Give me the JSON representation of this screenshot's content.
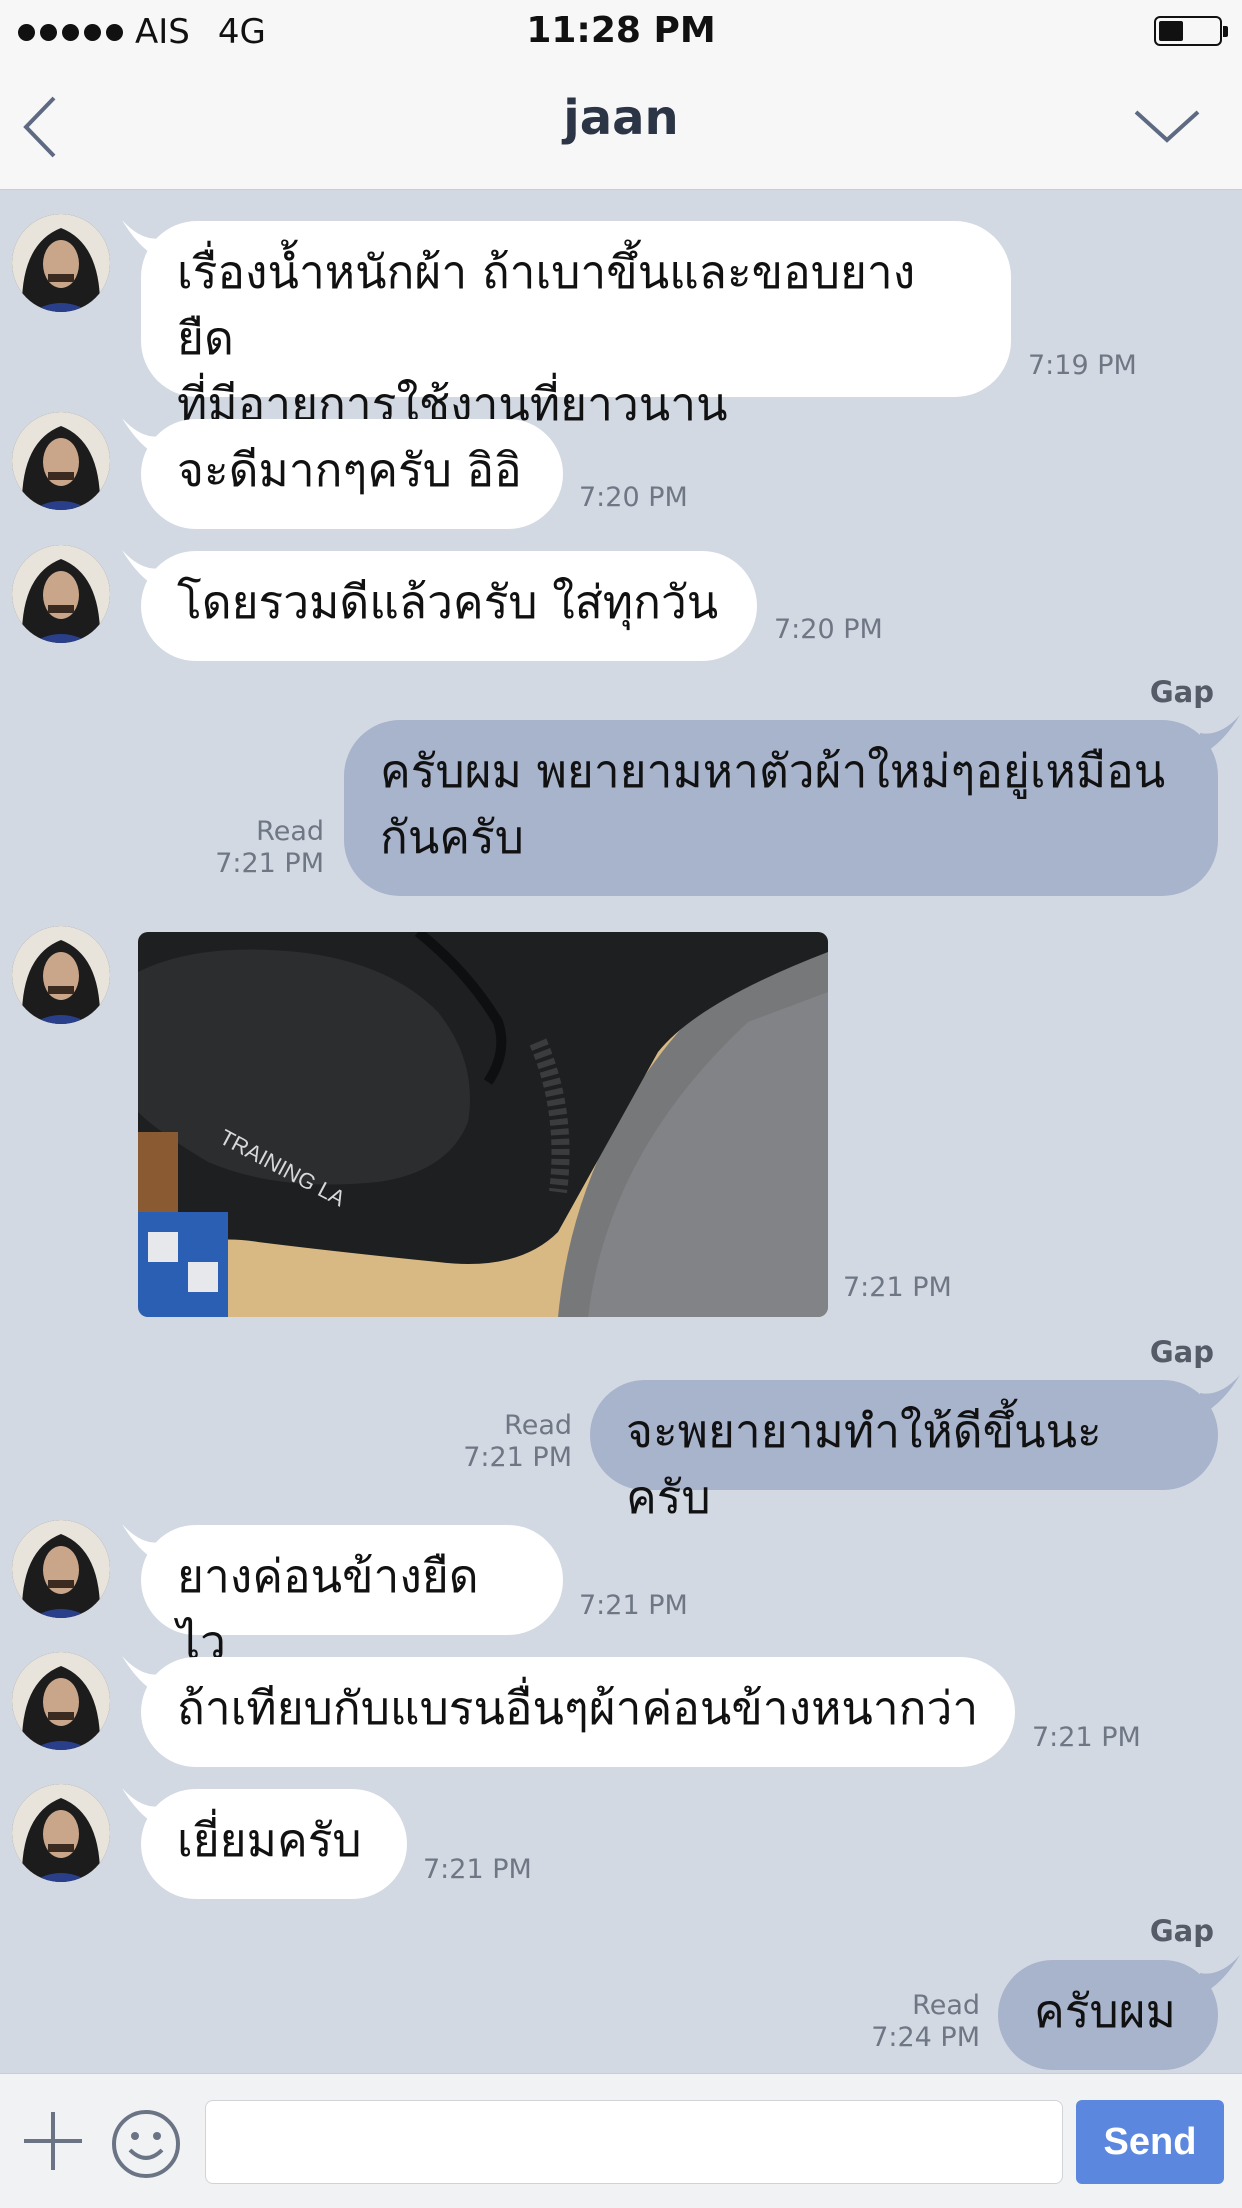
{
  "status_bar": {
    "carrier": "AIS",
    "network": "4G",
    "time": "11:28 PM"
  },
  "header": {
    "title": "jaan",
    "back_icon": "chevron-left-icon",
    "menu_icon": "chevron-down-icon"
  },
  "messages": [
    {
      "direction": "in",
      "lines": [
        "เรื่องน้ำหนักผ้า ถ้าเบาขึ้นและขอบยาง ยืด",
        "ที่มีอายุการใช้งานที่ยาวนาน"
      ],
      "time": "7:19 PM"
    },
    {
      "direction": "in",
      "lines": [
        "จะดีมากๆครับ อิอิ"
      ],
      "time": "7:20 PM"
    },
    {
      "direction": "in",
      "lines": [
        "โดยรวมดีแล้วครับ ใส่ทุกวัน"
      ],
      "time": "7:20 PM"
    },
    {
      "direction": "out",
      "sender": "Gap",
      "lines": [
        "ครับผม พยายามหาตัวผ้าใหม่ๆอยู่เหมือน",
        "กันครับ"
      ],
      "status": "Read",
      "time": "7:21 PM"
    },
    {
      "direction": "in",
      "type": "image",
      "image_text": "TRAINING LA",
      "time": "7:21 PM"
    },
    {
      "direction": "out",
      "sender": "Gap",
      "lines": [
        "จะพยายามทำให้ดีขึ้นนะครับ"
      ],
      "status": "Read",
      "time": "7:21 PM"
    },
    {
      "direction": "in",
      "lines": [
        "ยางค่อนข้างยืดไว"
      ],
      "time": "7:21 PM"
    },
    {
      "direction": "in",
      "lines": [
        "ถ้าเทียบกับแบรนอื่นๆผ้าค่อนข้างหนากว่า"
      ],
      "time": "7:21 PM"
    },
    {
      "direction": "in",
      "lines": [
        "เยี่ยมครับ"
      ],
      "time": "7:21 PM"
    },
    {
      "direction": "out",
      "sender": "Gap",
      "lines": [
        "ครับผม"
      ],
      "status": "Read",
      "time": "7:24 PM"
    }
  ],
  "input_bar": {
    "plus_icon": "plus-icon",
    "emoji_icon": "emoji-icon",
    "placeholder": "",
    "send_label": "Send"
  },
  "colors": {
    "background": "#d2d9e3",
    "incoming_bubble": "#ffffff",
    "outgoing_bubble": "#a8b3cc",
    "send_button": "#5c87de"
  }
}
